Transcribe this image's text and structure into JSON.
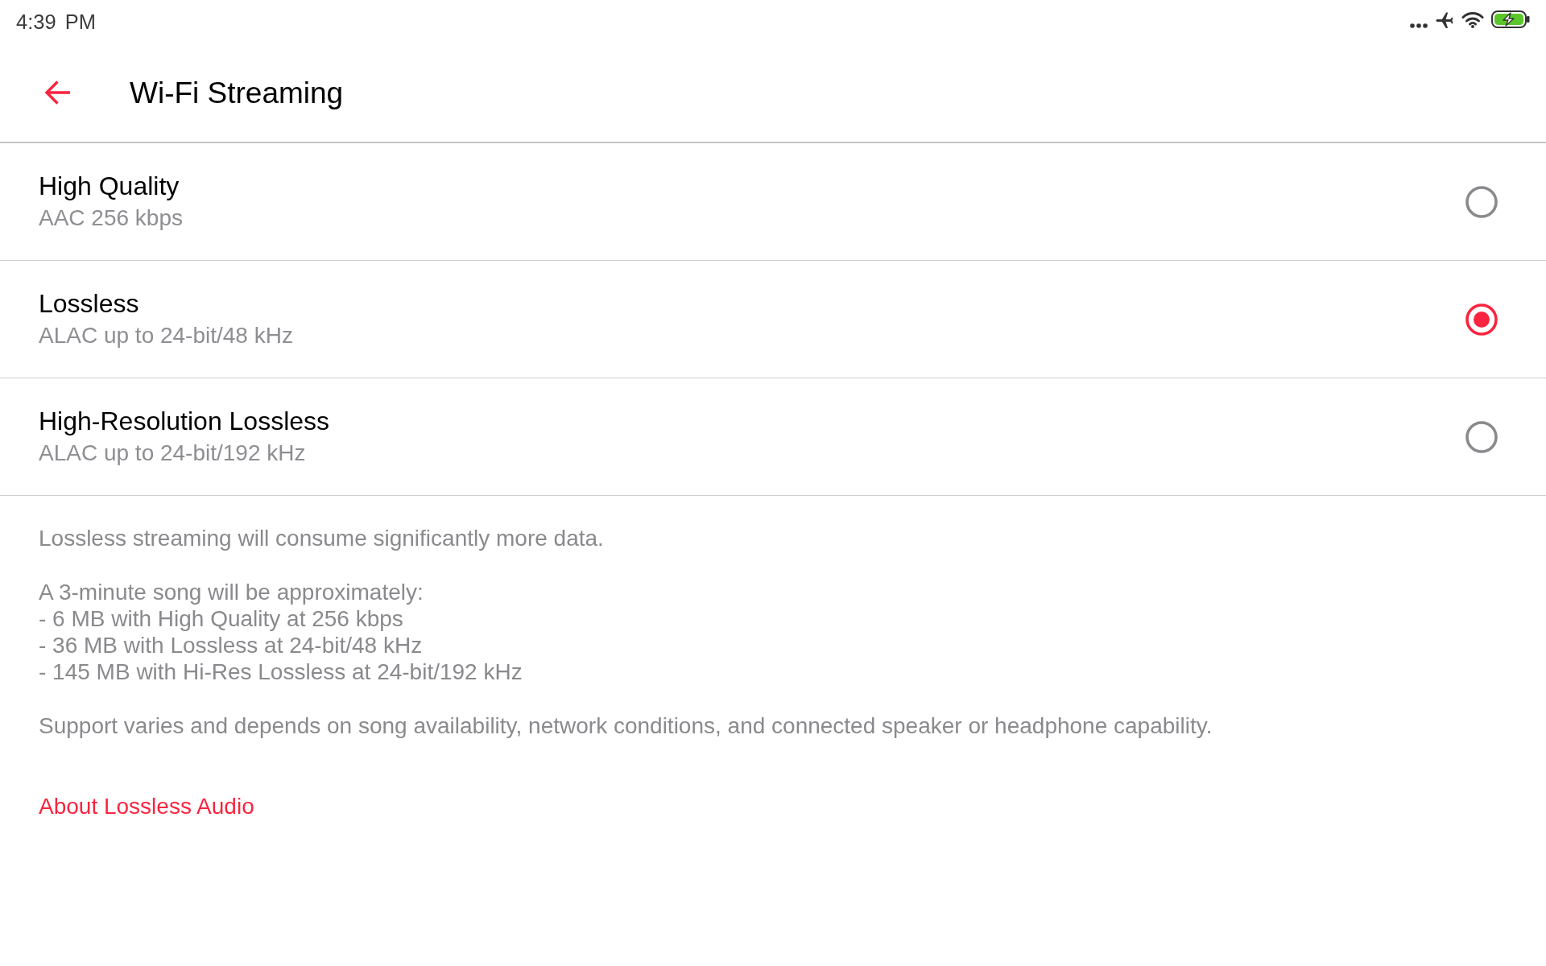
{
  "status_bar": {
    "time": "4:39 PM"
  },
  "header": {
    "title": "Wi-Fi Streaming"
  },
  "options": [
    {
      "title": "High Quality",
      "subtitle": "AAC 256 kbps",
      "selected": false
    },
    {
      "title": "Lossless",
      "subtitle": "ALAC up to 24-bit/48 kHz",
      "selected": true
    },
    {
      "title": "High-Resolution Lossless",
      "subtitle": "ALAC up to 24-bit/192 kHz",
      "selected": false
    }
  ],
  "notes": {
    "data_usage": "Lossless streaming will consume significantly more data.",
    "estimate_intro": "A 3-minute song will be approximately:",
    "estimate_lines": [
      "- 6 MB with High Quality at 256 kbps",
      "- 36 MB with Lossless at 24-bit/48 kHz",
      "- 145 MB with Hi-Res Lossless at 24-bit/192 kHz"
    ],
    "support": "Support varies and depends on song availability, network conditions, and connected speaker or headphone capability."
  },
  "link": {
    "label": "About Lossless Audio"
  }
}
